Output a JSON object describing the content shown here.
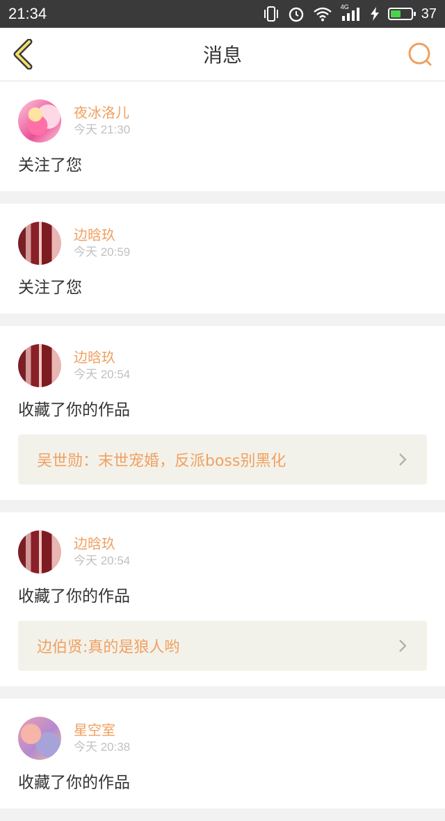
{
  "status_bar": {
    "time": "21:34",
    "network": "4G",
    "battery_level": "37",
    "icons": [
      "vibrate-icon",
      "alarm-icon",
      "wifi-icon",
      "signal-icon",
      "charging-icon",
      "battery-icon"
    ]
  },
  "header": {
    "title": "消息",
    "back_icon": "chevron-left-icon",
    "search_icon": "search-icon",
    "accent_color": "#f0a060"
  },
  "messages": [
    {
      "name": "夜冰洛儿",
      "time": "今天 21:30",
      "action": "关注了您"
    },
    {
      "name": "边晗玖",
      "time": "今天 20:59",
      "action": "关注了您"
    },
    {
      "name": "边晗玖",
      "time": "今天 20:54",
      "action": "收藏了你的作品",
      "work": "吴世勋：末世宠婚，反派boss别黑化"
    },
    {
      "name": "边晗玖",
      "time": "今天 20:54",
      "action": "收藏了你的作品",
      "work": "边伯贤:真的是狼人哟"
    },
    {
      "name": "星空室",
      "time": "今天 20:38",
      "action": "收藏了你的作品"
    }
  ]
}
